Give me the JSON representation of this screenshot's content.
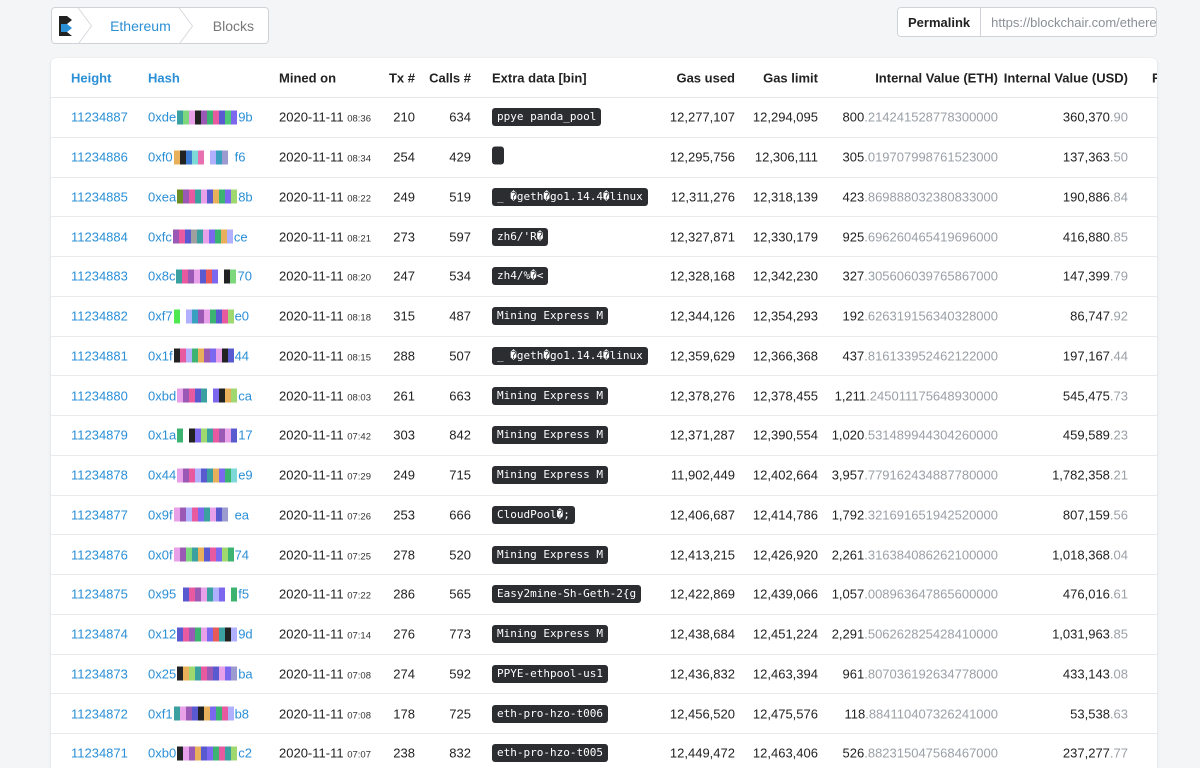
{
  "breadcrumb": {
    "chain": "Ethereum",
    "section": "Blocks"
  },
  "permalink": {
    "label": "Permalink",
    "url": "https://blockchair.com/ethereu"
  },
  "table": {
    "columns": [
      "Height",
      "Hash",
      "Mined on",
      "Tx #",
      "Calls #",
      "Extra data [bin]",
      "Gas used",
      "Gas limit",
      "Internal Value (ETH)",
      "Internal Value (USD)",
      "Fe"
    ],
    "rows": [
      {
        "height": "11234887",
        "hash_pre": "0xde",
        "hash_post": "9b",
        "hash_colors": [
          "#3aa0a0",
          "#7dd87d",
          "#e8a0e8",
          "#222",
          "#9b59b6",
          "#3cb371",
          "#e85aa0",
          "#5a5ad0",
          "#50c878",
          "#7b68ee"
        ],
        "date": "2020-11-11",
        "time": "08:36",
        "tx": "210",
        "calls": "634",
        "extra": "ppye panda_pool",
        "gas_used": "12,277,107",
        "gas_limit": "12,294,095",
        "ieth_int": "800",
        "ieth_frac": ".214241528778300000",
        "iusd_int": "360,370",
        "iusd_frac": ".90"
      },
      {
        "height": "11234886",
        "hash_pre": "0xf0",
        "hash_post": "f6",
        "hash_colors": [
          "#e8b05a",
          "#222",
          "#3a7ad0",
          "#7dd8d8",
          "#e870b0",
          "#fff",
          "#b0b0ff",
          "#3aa0c0",
          "#9b9bd0",
          "#fff"
        ],
        "date": "2020-11-11",
        "time": "08:34",
        "tx": "254",
        "calls": "429",
        "extra": "",
        "gas_used": "12,295,756",
        "gas_limit": "12,306,111",
        "ieth_int": "305",
        "ieth_frac": ".019707998761523000",
        "iusd_int": "137,363",
        "iusd_frac": ".50"
      },
      {
        "height": "11234885",
        "hash_pre": "0xea",
        "hash_post": "8b",
        "hash_colors": [
          "#6b8e23",
          "#9b59b6",
          "#e85aa0",
          "#3aa0a0",
          "#e8a0e8",
          "#5a5ad0",
          "#e8b05a",
          "#3cb371",
          "#7b68ee",
          "#a0d870"
        ],
        "date": "2020-11-11",
        "time": "08:22",
        "tx": "249",
        "calls": "519",
        "extra": "_ �geth�go1.14.4�linux",
        "gas_used": "12,311,276",
        "gas_limit": "12,318,139",
        "ieth_int": "423",
        "ieth_frac": ".869888032380833000",
        "iusd_int": "190,886",
        "iusd_frac": ".84"
      },
      {
        "height": "11234884",
        "hash_pre": "0xfc",
        "hash_post": "ce",
        "hash_colors": [
          "#9b59b6",
          "#e85aa0",
          "#5a5ad0",
          "#a0a0a0",
          "#3aa0a0",
          "#e8a0e8",
          "#7b68ee",
          "#3cb371",
          "#e8b05a",
          "#b0b0ff"
        ],
        "date": "2020-11-11",
        "time": "08:21",
        "tx": "273",
        "calls": "597",
        "extra": "zh6/'R�",
        "gas_used": "12,327,871",
        "gas_limit": "12,330,179",
        "ieth_int": "925",
        "ieth_frac": ".696260465419696000",
        "iusd_int": "416,880",
        "iusd_frac": ".85"
      },
      {
        "height": "11234883",
        "hash_pre": "0x8c",
        "hash_post": "70",
        "hash_colors": [
          "#3aa0a0",
          "#e85aa0",
          "#9b59b6",
          "#e8a0e8",
          "#5a5ad0",
          "#e85a5a",
          "#7b68ee",
          "#fff",
          "#222",
          "#7dd87d"
        ],
        "date": "2020-11-11",
        "time": "08:20",
        "tx": "247",
        "calls": "534",
        "extra": "zh4/%�<",
        "gas_used": "12,328,168",
        "gas_limit": "12,342,230",
        "ieth_int": "327",
        "ieth_frac": ".305606039765867000",
        "iusd_int": "147,399",
        "iusd_frac": ".79"
      },
      {
        "height": "11234882",
        "hash_pre": "0xf7",
        "hash_post": "e0",
        "hash_colors": [
          "#50e850",
          "#fff",
          "#b0b0ff",
          "#3aa0c0",
          "#9b59b6",
          "#e8a0e8",
          "#3cb371",
          "#5a5ad0",
          "#e85aa0",
          "#a0d870"
        ],
        "date": "2020-11-11",
        "time": "08:18",
        "tx": "315",
        "calls": "487",
        "extra": "Mining Express M",
        "gas_used": "12,344,126",
        "gas_limit": "12,354,293",
        "ieth_int": "192",
        "ieth_frac": ".626319156340328000",
        "iusd_int": "86,747",
        "iusd_frac": ".92"
      },
      {
        "height": "11234881",
        "hash_pre": "0x1f",
        "hash_post": "44",
        "hash_colors": [
          "#222",
          "#e85aa0",
          "#b0b0ff",
          "#3cb371",
          "#e8b05a",
          "#9b59b6",
          "#7b68ee",
          "#e8a0e8",
          "#222",
          "#5a5ad0"
        ],
        "date": "2020-11-11",
        "time": "08:15",
        "tx": "288",
        "calls": "507",
        "extra": "_ �geth�go1.14.4�linux",
        "gas_used": "12,359,629",
        "gas_limit": "12,366,368",
        "ieth_int": "437",
        "ieth_frac": ".816133952462122000",
        "iusd_int": "197,167",
        "iusd_frac": ".44"
      },
      {
        "height": "11234880",
        "hash_pre": "0xbd",
        "hash_post": "ca",
        "hash_colors": [
          "#e8a0e8",
          "#9b59b6",
          "#e85aa0",
          "#5a5ad0",
          "#3aa0a0",
          "#fff",
          "#7b68ee",
          "#222",
          "#e8b05a",
          "#a0d870"
        ],
        "date": "2020-11-11",
        "time": "08:03",
        "tx": "261",
        "calls": "663",
        "extra": "Mining Express M",
        "gas_used": "12,378,276",
        "gas_limit": "12,378,455",
        "ieth_int": "1,211",
        "ieth_frac": ".245011175648930000",
        "iusd_int": "545,475",
        "iusd_frac": ".73"
      },
      {
        "height": "11234879",
        "hash_pre": "0x1a",
        "hash_post": "17",
        "hash_colors": [
          "#3cb371",
          "#fff",
          "#222",
          "#7b68ee",
          "#a0d870",
          "#3aa0a0",
          "#e85aa0",
          "#9b59b6",
          "#e8a0e8",
          "#5a5ad0"
        ],
        "date": "2020-11-11",
        "time": "07:42",
        "tx": "303",
        "calls": "842",
        "extra": "Mining Express M",
        "gas_used": "12,371,287",
        "gas_limit": "12,390,554",
        "ieth_int": "1,020",
        "ieth_frac": ".531489944304260000",
        "iusd_int": "459,589",
        "iusd_frac": ".23"
      },
      {
        "height": "11234878",
        "hash_pre": "0x44",
        "hash_post": "e9",
        "hash_colors": [
          "#e8a0e8",
          "#9b59b6",
          "#e85aa0",
          "#b0b0ff",
          "#5a5ad0",
          "#3aa0a0",
          "#e8b05a",
          "#7b68ee",
          "#3cb371",
          "#7dd8d8"
        ],
        "date": "2020-11-11",
        "time": "07:29",
        "tx": "249",
        "calls": "715",
        "extra": "Mining Express M",
        "gas_used": "11,902,449",
        "gas_limit": "12,402,664",
        "ieth_int": "3,957",
        "ieth_frac": ".779162434887780000",
        "iusd_int": "1,782,358",
        "iusd_frac": ".21"
      },
      {
        "height": "11234877",
        "hash_pre": "0x9f",
        "hash_post": "ea",
        "hash_colors": [
          "#e8a0e8",
          "#9b59b6",
          "#b0b0ff",
          "#e85aa0",
          "#7b68ee",
          "#3aa0a0",
          "#e8a0e8",
          "#5a5ad0",
          "#9b9bd0",
          "#fff"
        ],
        "date": "2020-11-11",
        "time": "07:26",
        "tx": "253",
        "calls": "666",
        "extra": "CloudPool�;",
        "gas_used": "12,406,687",
        "gas_limit": "12,414,786",
        "ieth_int": "1,792",
        "ieth_frac": ".321691651942520000",
        "iusd_int": "807,159",
        "iusd_frac": ".56"
      },
      {
        "height": "11234876",
        "hash_pre": "0x0f",
        "hash_post": "74",
        "hash_colors": [
          "#e8a0e8",
          "#9b59b6",
          "#7dd87d",
          "#3aa0a0",
          "#e8b05a",
          "#5a5ad0",
          "#e85aa0",
          "#7b68ee",
          "#a0d870",
          "#3cb371"
        ],
        "date": "2020-11-11",
        "time": "07:25",
        "tx": "278",
        "calls": "520",
        "extra": "Mining Express M",
        "gas_used": "12,413,215",
        "gas_limit": "12,426,920",
        "ieth_int": "2,261",
        "ieth_frac": ".316384086262100000",
        "iusd_int": "1,018,368",
        "iusd_frac": ".04"
      },
      {
        "height": "11234875",
        "hash_pre": "0x95",
        "hash_post": "f5",
        "hash_colors": [
          "#fff",
          "#5a5ad0",
          "#e85aa0",
          "#9b59b6",
          "#e8a0e8",
          "#3aa0a0",
          "#b0b0ff",
          "#7b68ee",
          "#fff",
          "#3cb371"
        ],
        "date": "2020-11-11",
        "time": "07:22",
        "tx": "286",
        "calls": "565",
        "extra": "Easy2mine-Sh-Geth-2{g",
        "gas_used": "12,422,869",
        "gas_limit": "12,439,066",
        "ieth_int": "1,057",
        "ieth_frac": ".008963647865600000",
        "iusd_int": "476,016",
        "iusd_frac": ".61"
      },
      {
        "height": "11234874",
        "hash_pre": "0x12",
        "hash_post": "9d",
        "hash_colors": [
          "#5a5ad0",
          "#e85aa0",
          "#9b59b6",
          "#3cb371",
          "#e8a0e8",
          "#7b68ee",
          "#e85a5a",
          "#3aa0a0",
          "#222",
          "#b0b0ff"
        ],
        "date": "2020-11-11",
        "time": "07:14",
        "tx": "276",
        "calls": "773",
        "extra": "Mining Express M",
        "gas_used": "12,438,684",
        "gas_limit": "12,451,224",
        "ieth_int": "2,291",
        "ieth_frac": ".506262825428410000",
        "iusd_int": "1,031,963",
        "iusd_frac": ".85"
      },
      {
        "height": "11234873",
        "hash_pre": "0x25",
        "hash_post": "ba",
        "hash_colors": [
          "#222",
          "#e8b05a",
          "#a0d870",
          "#3aa0a0",
          "#e85aa0",
          "#9b59b6",
          "#5a5ad0",
          "#e8a0e8",
          "#7b68ee",
          "#9b9bd0"
        ],
        "date": "2020-11-11",
        "time": "07:08",
        "tx": "274",
        "calls": "592",
        "extra": "PPYE-ethpool-us1",
        "gas_used": "12,436,832",
        "gas_limit": "12,463,394",
        "ieth_int": "961",
        "ieth_frac": ".807036192634778000",
        "iusd_int": "433,143",
        "iusd_frac": ".08"
      },
      {
        "height": "11234872",
        "hash_pre": "0xf1",
        "hash_post": "b8",
        "hash_colors": [
          "#3aa0a0",
          "#e8a0e8",
          "#9b59b6",
          "#5a5ad0",
          "#222",
          "#e8b05a",
          "#7b68ee",
          "#3cb371",
          "#e85aa0",
          "#b0b0ff"
        ],
        "date": "2020-11-11",
        "time": "07:08",
        "tx": "178",
        "calls": "725",
        "extra": "eth-pro-hzo-t006",
        "gas_used": "12,456,520",
        "gas_limit": "12,475,576",
        "ieth_int": "118",
        "ieth_frac": ".884110407326241000",
        "iusd_int": "53,538",
        "iusd_frac": ".63"
      },
      {
        "height": "11234871",
        "hash_pre": "0xb0",
        "hash_post": "c2",
        "hash_colors": [
          "#222",
          "#e8a0e8",
          "#9b59b6",
          "#e8b05a",
          "#5a5ad0",
          "#7b68ee",
          "#3cb371",
          "#e85aa0",
          "#3aa0a0",
          "#a0d870"
        ],
        "date": "2020-11-11",
        "time": "07:07",
        "tx": "238",
        "calls": "832",
        "extra": "eth-pro-hzo-t005",
        "gas_used": "12,449,472",
        "gas_limit": "12,463,406",
        "ieth_int": "526",
        "ieth_frac": ".882315047568467000",
        "iusd_int": "237,277",
        "iusd_frac": ".77"
      }
    ]
  }
}
